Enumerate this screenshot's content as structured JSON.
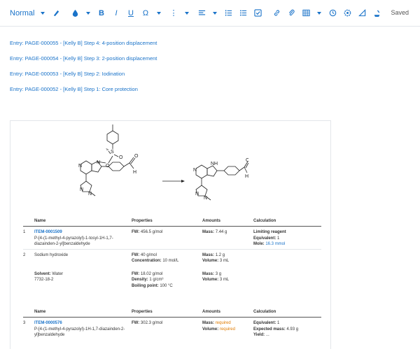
{
  "toolbar": {
    "style_label": "Normal",
    "saved_label": "Saved",
    "bold": "B",
    "italic": "I",
    "underline": "U",
    "omega": "Ω",
    "more": "⋮"
  },
  "entries": [
    "Entry: PAGE-000055 - [Kelly B] Step 4: 4-position displacement",
    "Entry: PAGE-000054 - [Kelly B] Step 3: 2-position displacement",
    "Entry: PAGE-000053 - [Kelly B] Step 2: Iodination",
    "Entry: PAGE-000052 - [Kelly B] Step 1: Core protection"
  ],
  "reactants_table": {
    "headers": [
      "Name",
      "Properties",
      "Amounts",
      "Calculation"
    ],
    "rows": [
      {
        "index": "1",
        "item": "ITEM-0001509",
        "name": "P-[4-(1-methyl-4-pyrazolyl)-1-tosyl-1H-1,7-diazainden-2-yl]benzaldehyde",
        "fw_label": "FW:",
        "fw": "456.5 g/mol",
        "mass_label": "Mass:",
        "mass": "7.44 g",
        "calc1": "Limiting reagent",
        "calc2_label": "Equivalent:",
        "calc2": "1",
        "calc3_label": "Mole:",
        "calc3": "16.3 mmol"
      },
      {
        "index": "2",
        "name": "Sodium hydroxide",
        "fw_label": "FW:",
        "fw": "40 g/mol",
        "conc_label": "Concentration:",
        "conc": "10 mol/L",
        "mass_label": "Mass:",
        "mass": "1.2 g",
        "vol_label": "Volume:",
        "vol": "3 mL"
      },
      {
        "solvent_label": "Solvent:",
        "solvent": "Water",
        "cas": "7732-18-2",
        "fw_label": "FW:",
        "fw": "18.02 g/mol",
        "density_label": "Density:",
        "density": "1 g/cm³",
        "bp_label": "Boiling point:",
        "bp": "100 °C",
        "mass_label": "Mass:",
        "mass": "3 g",
        "vol_label": "Volume:",
        "vol": "3 mL"
      }
    ]
  },
  "products_table": {
    "headers": [
      "Name",
      "Properties",
      "Amounts",
      "Calculation"
    ],
    "rows": [
      {
        "index": "3",
        "item": "ITEM-0000576",
        "name": "P-[4-(1-methyl-4-pyrazolyl)-1H-1,7-diazainden-2-yl]benzaldehyde",
        "fw_label": "FW:",
        "fw": "302.3 g/mol",
        "mass_label": "Mass:",
        "mass": "required",
        "vol_label": "Volume:",
        "vol": "required",
        "calc1_label": "Equivalent:",
        "calc1": "1",
        "calc2_label": "Expected mass:",
        "calc2": "4.93 g",
        "calc3_label": "Yield:",
        "calc3": "..."
      }
    ]
  },
  "scheme": {
    "ts_label": "Ts",
    "s_label": "S",
    "o_label": "O",
    "n_label": "N",
    "h_label": "H",
    "nh_label": "NH"
  },
  "colors": {
    "accent": "#1a73c9",
    "required": "#e07b00"
  }
}
